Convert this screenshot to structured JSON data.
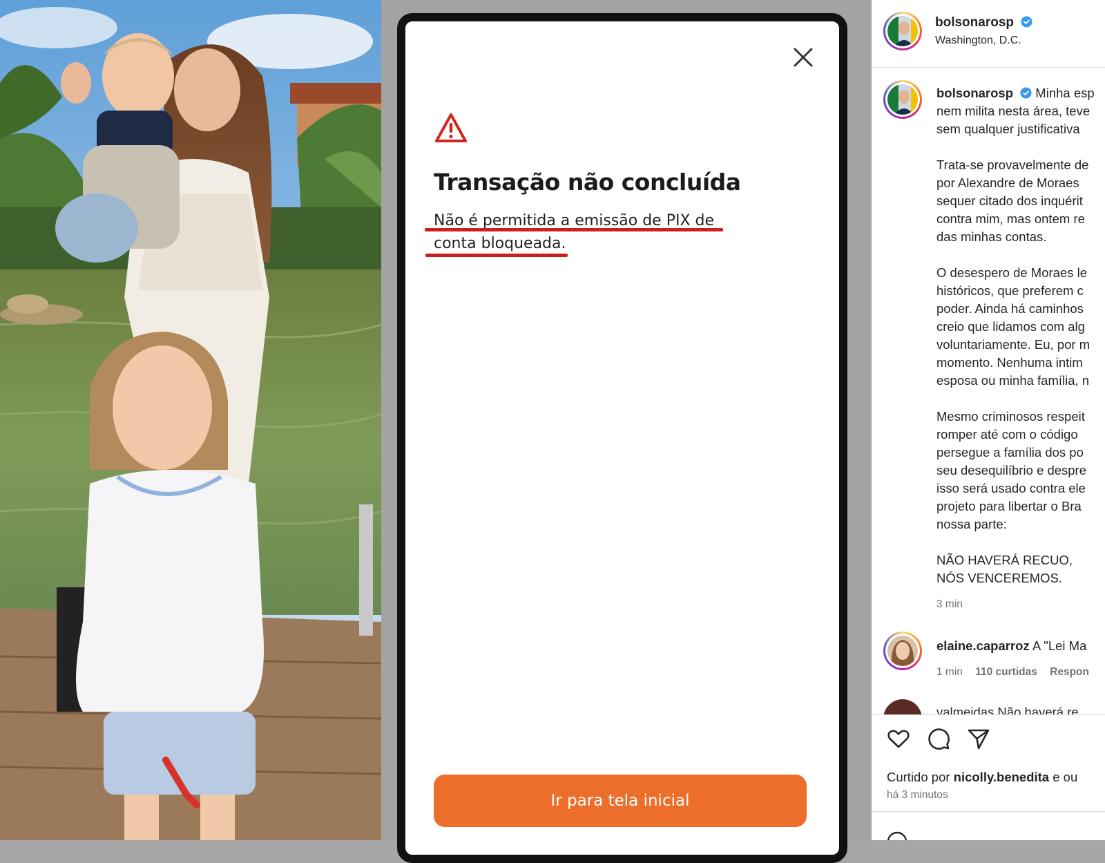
{
  "phone": {
    "title": "Transação não concluída",
    "message_line1": "Não é permitida a emissão de PIX de",
    "message_line2": "conta bloqueada.",
    "button_label": "Ir para tela inicial",
    "accent_color": "#ec6e2a",
    "alert_color": "#c9211e"
  },
  "post": {
    "header": {
      "username": "bolsonarosp",
      "location": "Washington, D.C."
    },
    "caption": {
      "username": "bolsonarosp",
      "lines": [
        "Minha esp",
        "nem milita nesta área, teve",
        "sem qualquer justificativa"
      ],
      "paragraph2": [
        "Trata-se provavelmente de",
        "por Alexandre de Moraes",
        "sequer citado dos inquérit",
        "contra mim, mas ontem re",
        "das minhas contas."
      ],
      "paragraph3": [
        "O desespero de Moraes le",
        "históricos, que preferem c",
        "poder. Ainda há caminhos",
        "creio que lidamos com alg",
        "voluntariamente. Eu, por m",
        "momento. Nenhuma intim",
        "esposa ou minha família, n"
      ],
      "paragraph4": [
        "Mesmo criminosos respeit",
        "romper até com o código",
        "persegue a família dos po",
        "seu desequilíbrio e despre",
        "isso será usado contra ele",
        "projeto para libertar o Bra",
        "nossa parte:"
      ],
      "paragraph5": [
        "NÃO HAVERÁ RECUO,",
        "NÓS VENCEREMOS."
      ],
      "time": "3 min"
    },
    "comment": {
      "username": "elaine.caparroz",
      "text": "A \"Lei Ma",
      "time": "1 min",
      "likes": "110 curtidas",
      "reply": "Respon"
    },
    "cut_comment": "valmeidas  Não haverá re",
    "liked_by_prefix": "Curtido por",
    "liked_by_user": "nicolly.benedita",
    "liked_by_suffix": "e ou",
    "date": "há 3 minutos",
    "icons": [
      "heart-icon",
      "comment-icon",
      "share-icon"
    ]
  }
}
